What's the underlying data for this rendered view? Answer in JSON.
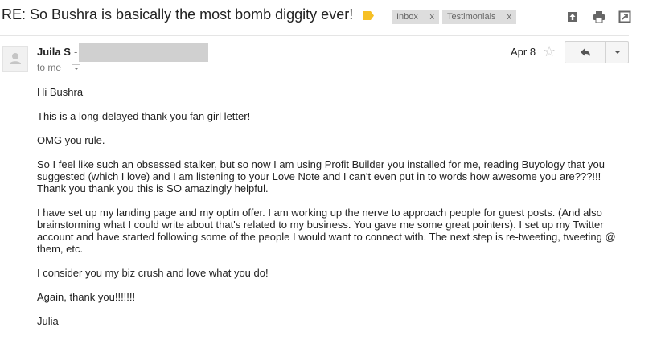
{
  "subject": "RE: So Bushra is basically the most bomb diggity ever!",
  "labels": [
    {
      "name": "Inbox",
      "remove": "x"
    },
    {
      "name": "Testimonials",
      "remove": "x"
    }
  ],
  "toolbar_icons": [
    "open-in-new-window-icon",
    "print-icon",
    "expand-icon"
  ],
  "sender": {
    "name": "Juila S",
    "separator": "-"
  },
  "recipient": "to me",
  "date": "Apr 8",
  "icons": {
    "star": "star-icon",
    "reply": "reply-icon",
    "more": "more-actions-icon",
    "label": "label-tag-icon"
  },
  "colors": {
    "label_tag": "#f6c026",
    "chip_bg": "#dddddd",
    "muted": "#777777"
  },
  "body": {
    "greeting": "Hi Bushra",
    "p1": "This is a long-delayed thank you fan girl letter!",
    "p2": "OMG you rule.",
    "p3": "So I feel like such an obsessed stalker, but so now I am using Profit Builder you installed for me, reading Buyology that you suggested (which I love) and I am listening to your Love Note and I can't even put in to words how awesome you are???!!! Thank you thank you this is SO amazingly helpful.",
    "p4": "I have set up my landing page and my optin offer. I am working up the nerve to approach people for guest posts. (And also brainstorming what I could write about that's related to my business. You gave me some great pointers). I set up my Twitter account and have started following some of the people I would want to connect with. The next step is re-tweeting, tweeting @ them, etc.",
    "p5": "I consider you my biz crush and love what you do!",
    "p6": "Again, thank you!!!!!!!",
    "signature": "Julia"
  }
}
